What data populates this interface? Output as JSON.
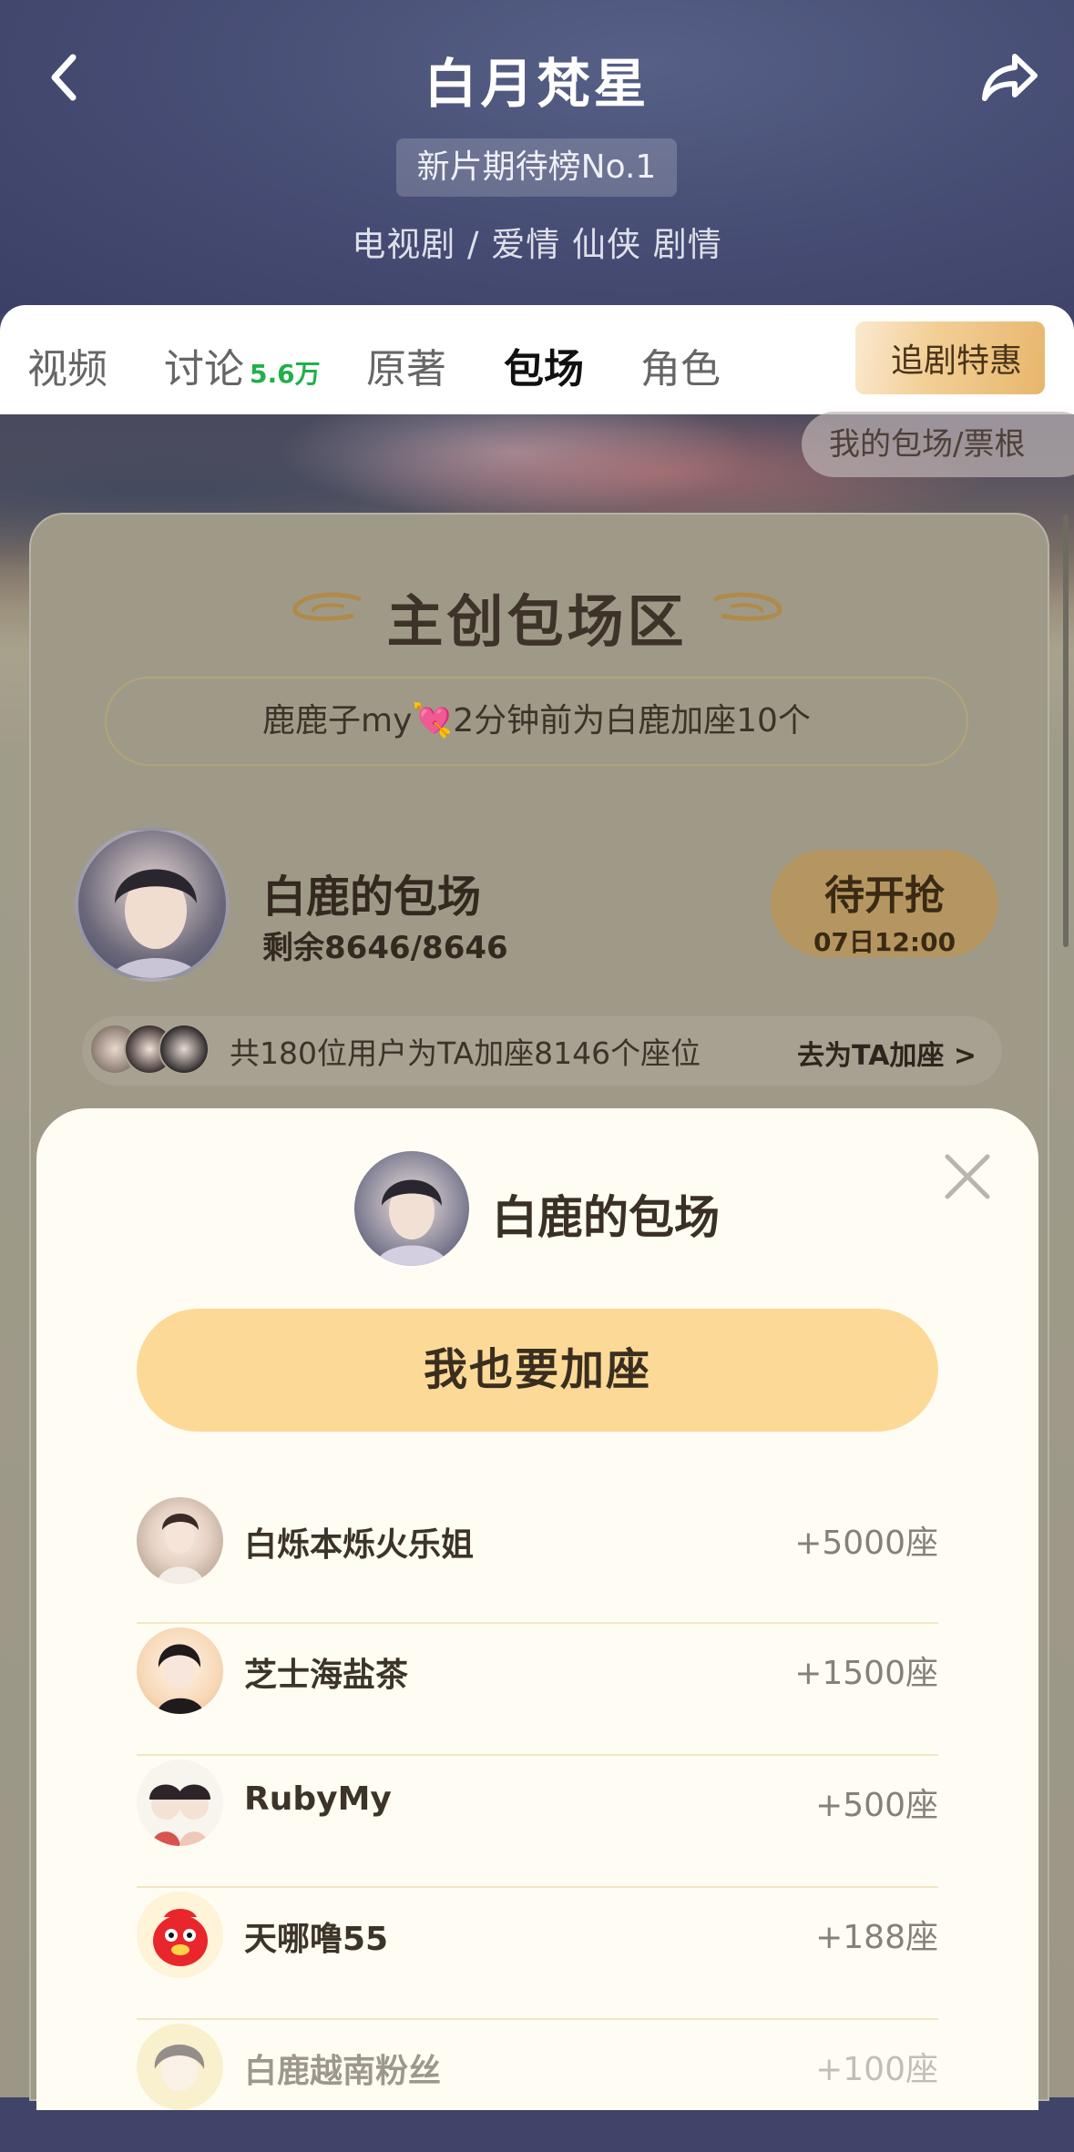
{
  "header": {
    "title": "白月梵星",
    "rank_badge": "新片期待榜No.1",
    "genres": "电视剧 / 爱情 仙侠 剧情"
  },
  "tabs": [
    {
      "label": "视频"
    },
    {
      "label": "讨论",
      "count": "5.6万"
    },
    {
      "label": "原著"
    },
    {
      "label": "包场",
      "active": true
    },
    {
      "label": "角色"
    }
  ],
  "promo_label": "追剧特惠",
  "my_tickets_label": "我的包场/票根",
  "zone": {
    "title": "主创包场区",
    "ticker_before": "鹿鹿子my",
    "ticker_after": "2分钟前为白鹿加座10个",
    "star_name": "白鹿的包场",
    "remaining": "剩余8646/8646",
    "grab_label": "待开抢",
    "grab_time": "07日12:00",
    "supporters_text": "共180位用户为TA加座8146个座位",
    "supporters_link": "去为TA加座 >"
  },
  "sheet": {
    "title": "白鹿的包场",
    "cta": "我也要加座",
    "rows": [
      {
        "name": "白烁本烁火乐姐",
        "seats": "+5000座"
      },
      {
        "name": "芝士海盐茶",
        "seats": "+1500座"
      },
      {
        "name": "RubyMy",
        "seats": "+500座"
      },
      {
        "name": "天哪噜55",
        "seats": "+188座"
      },
      {
        "name": "白鹿越南粉丝",
        "seats": "+100座"
      }
    ]
  },
  "colors": {
    "header_bg": "#454b72",
    "cta_bg": "#fdd998",
    "grab_bg": "#b69660",
    "discussion_count": "#21b04a",
    "sheet_bg": "#fffdf3"
  }
}
